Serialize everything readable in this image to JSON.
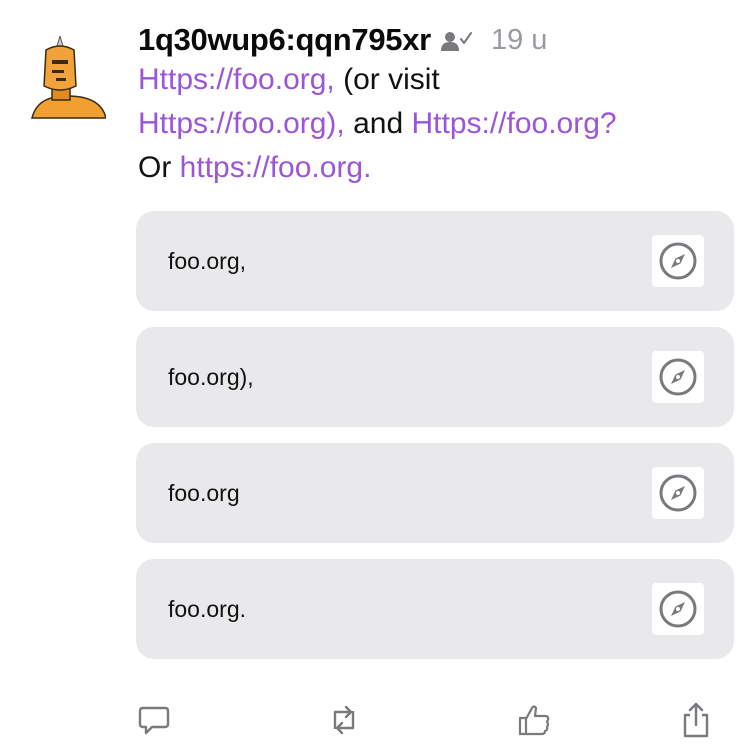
{
  "post": {
    "username": "1q30wup6:qqn795xr",
    "follow_icon": "person-checkmark-icon",
    "timestamp": "19 u",
    "content": {
      "link1": "Https://foo.org,",
      "text1": " (or visit ",
      "link2": "Https://foo.org),",
      "text2": " and ",
      "link3": "Https://foo.org?",
      "text3": " Or ",
      "link4": "https://foo.org."
    }
  },
  "link_cards": [
    {
      "label": "foo.org,",
      "icon": "compass-icon"
    },
    {
      "label": "foo.org),",
      "icon": "compass-icon"
    },
    {
      "label": "foo.org",
      "icon": "compass-icon"
    },
    {
      "label": "foo.org.",
      "icon": "compass-icon"
    }
  ],
  "actions": {
    "reply_icon": "speech-bubble-icon",
    "boost_icon": "repost-arrows-icon",
    "like_icon": "thumbs-up-icon",
    "share_icon": "share-icon"
  },
  "colors": {
    "link": "#9c55d9",
    "card_background": "#e9e9eb",
    "timestamp": "#9a9aa0",
    "icon_gray": "#7a7a7e",
    "avatar_orange": "#f0a030"
  }
}
